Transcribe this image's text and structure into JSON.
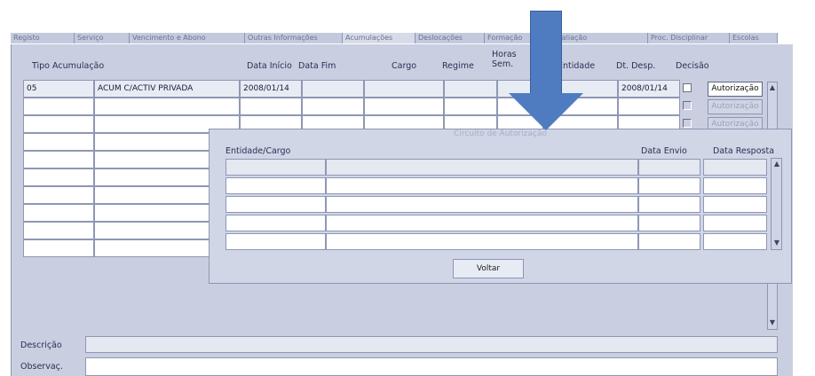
{
  "tabs": [
    "Registo",
    "Serviço",
    "Vencimento e Abono",
    "Outras Informações",
    "Acumulações",
    "Deslocações",
    "Formação",
    "Avaliação",
    "Proc. Disciplinar",
    "Escolas"
  ],
  "grid": {
    "headers": {
      "tipo": "Tipo Acumulação",
      "data_inicio": "Data Início",
      "data_fim": "Data Fim",
      "cargo": "Cargo",
      "regime": "Regime",
      "horas_line1": "Horas",
      "horas_line2": "Sem.",
      "entidade": "Entidade",
      "dt_desp": "Dt. Desp.",
      "decisao": "Decisão"
    },
    "first_row": {
      "code": "05",
      "tipo": "ACUM C/ACTIV PRIVADA",
      "data_inicio": "2008/01/14",
      "dt_desp": "2008/01/14"
    },
    "autorizacao_label": "Autorização"
  },
  "dialog": {
    "title": "Circuito de Autorização",
    "col_entidade": "Entidade/Cargo",
    "col_envio": "Data Envio",
    "col_resposta": "Data Resposta",
    "voltar_label": "Voltar"
  },
  "footer": {
    "descricao_label": "Descrição",
    "observac_label": "Observaç."
  },
  "colors": {
    "panel": "#c9cfe0",
    "arrow": "#4f7cc0"
  }
}
